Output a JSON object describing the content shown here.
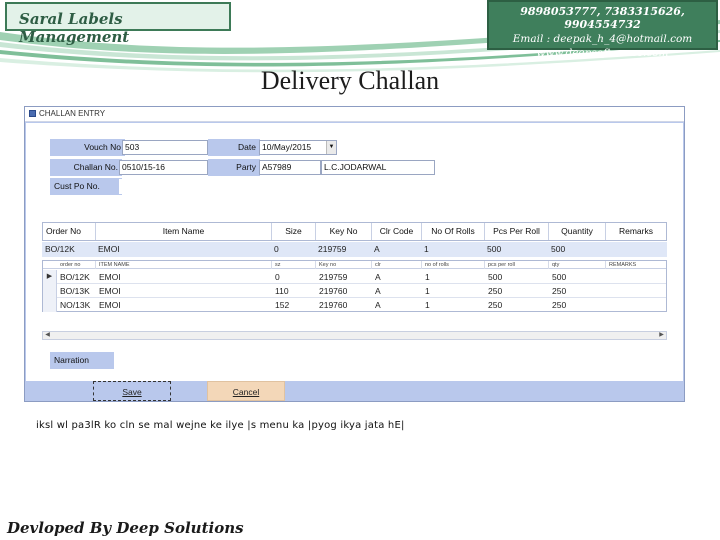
{
  "header": {
    "app_title": "Saral Labels Management",
    "phones": "9898053777, 7383315626, 9904554732",
    "email": "Email : deepak_h_4@hotmail.com",
    "website": "www.deepsoftwares.com",
    "accent_color": "#3f7f5c"
  },
  "page_title": "Delivery Challan",
  "window": {
    "title": "CHALLAN ENTRY",
    "form": {
      "vouch_no_label": "Vouch No",
      "vouch_no_value": "503",
      "date_label": "Date",
      "date_value": "10/May/2015",
      "challan_no_label": "Challan No.",
      "challan_no_value": "0510/15-16",
      "party_label": "Party",
      "party_code": "A57989",
      "party_name": "L.C.JODARWAL",
      "cust_po_label": "Cust Po No."
    },
    "grid": {
      "columns": [
        "Order No",
        "Item Name",
        "Size",
        "Key No",
        "Clr Code",
        "No Of Rolls",
        "Pcs Per Roll",
        "Quantity",
        "Remarks"
      ],
      "entry": [
        "BO/12K",
        "EMOI",
        "0",
        "219759",
        "A",
        "1",
        "500",
        "500",
        ""
      ],
      "sub_columns": [
        "order no",
        "ITEM NAME",
        "sz",
        "Key no",
        "clr",
        "no of rolls",
        "pcs per roll",
        "qty",
        "REMARKS"
      ],
      "rows": [
        [
          "BO/12K",
          "EMOI",
          "0",
          "219759",
          "A",
          "1",
          "500",
          "500",
          ""
        ],
        [
          "BO/13K",
          "EMOI",
          "110",
          "219760",
          "A",
          "1",
          "250",
          "250",
          ""
        ],
        [
          "NO/13K",
          "EMOI",
          "152",
          "219760",
          "A",
          "1",
          "250",
          "250",
          ""
        ]
      ],
      "row_indicator": "▶"
    },
    "narration_label": "Narration",
    "save_label": "Save",
    "cancel_label": "Cancel"
  },
  "hindi_note": "iksl wl pa3lR ko cln se mal wejne ke ilye |s menu ka |pyog ikya jata hE|",
  "footer": "Devloped By Deep Solutions"
}
